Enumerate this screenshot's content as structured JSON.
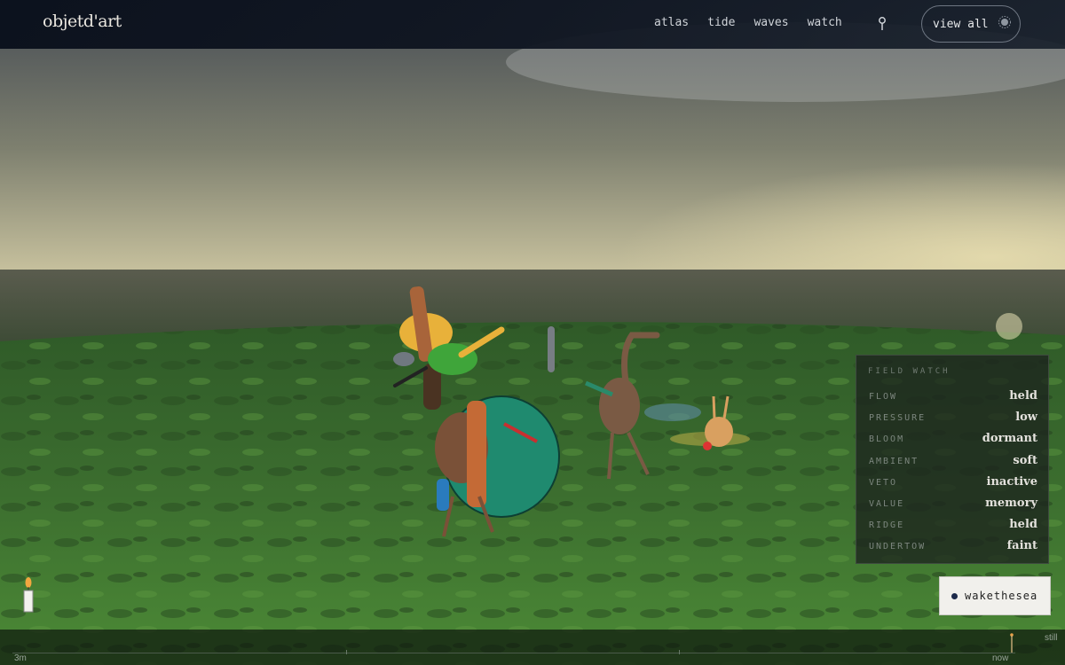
{
  "header": {
    "brand": "objetd'art",
    "nav": [
      "atlas",
      "tide",
      "waves",
      "watch"
    ],
    "pin_icon": "pin-icon",
    "view_all_label": "view all",
    "view_all_icon": "sparkle-icon"
  },
  "field_watch": {
    "title": "FIELD WATCH",
    "rows": [
      {
        "key": "FLOW",
        "value": "held"
      },
      {
        "key": "PRESSURE",
        "value": "low"
      },
      {
        "key": "BLOOM",
        "value": "dormant"
      },
      {
        "key": "AMBIENT",
        "value": "soft"
      },
      {
        "key": "VETO",
        "value": "inactive"
      },
      {
        "key": "VALUE",
        "value": "memory"
      },
      {
        "key": "RIDGE",
        "value": "held"
      },
      {
        "key": "UNDERTOW",
        "value": "faint"
      }
    ]
  },
  "wake_button": {
    "label": "wakethesea",
    "dot_color": "#1c2a4a"
  },
  "timeline": {
    "start_label": "3m",
    "end_label": "now",
    "mode_label": "still"
  },
  "candle_icon": "candle-icon",
  "colors": {
    "sky_top": "#4a5058",
    "horizon": "#cfc9a4",
    "grass": "#3f7a2c",
    "accent_teal": "#1f8a6f"
  }
}
